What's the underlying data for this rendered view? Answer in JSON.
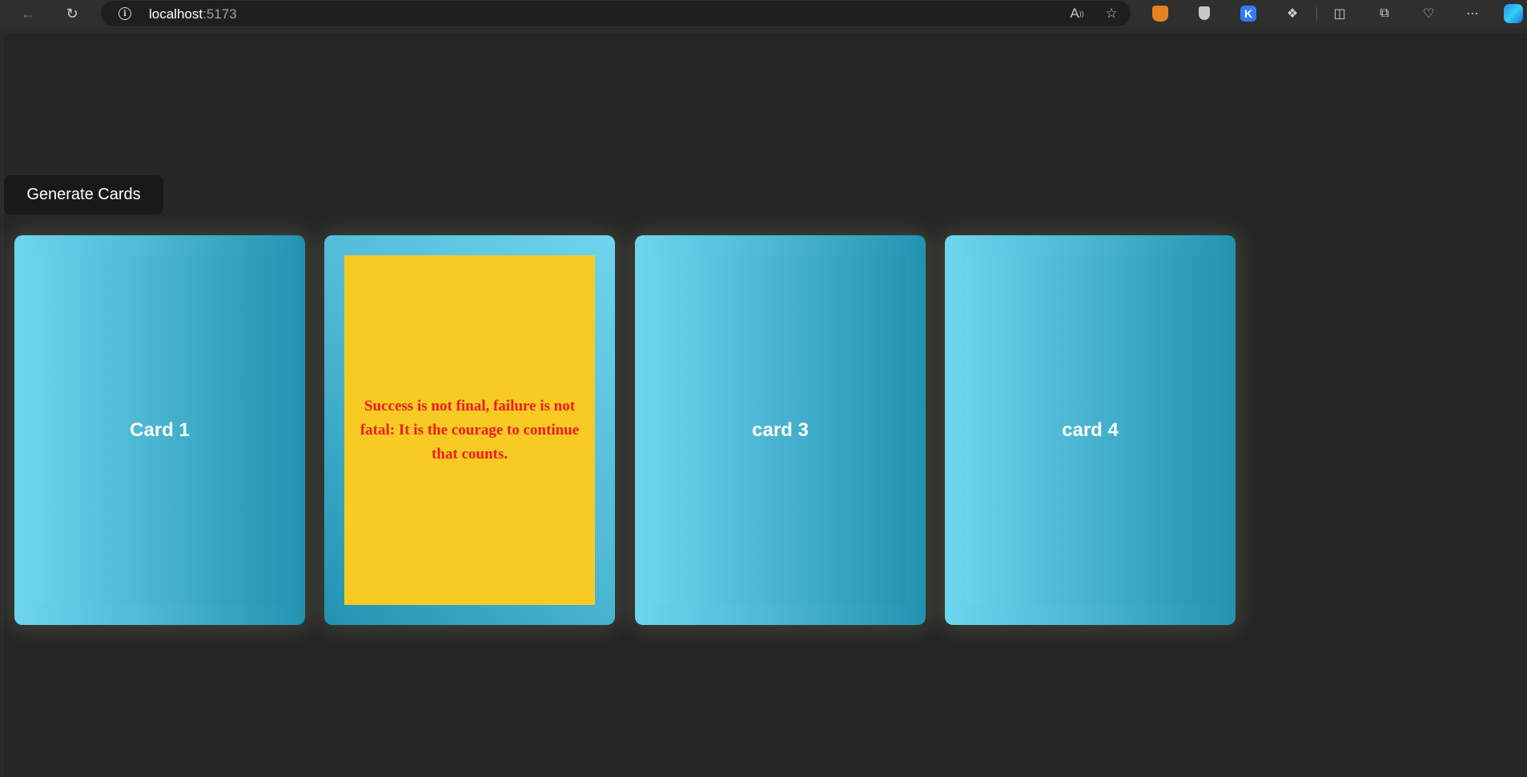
{
  "browser": {
    "url_host": "localhost",
    "url_port": ":5173"
  },
  "icons": {
    "back": "back-arrow-icon",
    "reload": "reload-icon",
    "info": "site-info-icon",
    "read_aloud": "read-aloud-icon",
    "favorite": "favorite-star-icon",
    "metamask": "metamask-extension-icon",
    "shield": "shield-extension-icon",
    "k_extension": "k-extension-icon",
    "extensions": "extensions-puzzle-icon",
    "split_screen": "split-screen-icon",
    "collections": "collections-icon",
    "browser_essentials": "browser-essentials-icon",
    "more": "more-options-icon",
    "copilot": "copilot-icon"
  },
  "page": {
    "generate_button": "Generate Cards",
    "cards": [
      {
        "label": "Card 1",
        "state": "front"
      },
      {
        "label": "Success is not final, failure is not fatal: It is the courage to continue that counts.",
        "state": "flipped"
      },
      {
        "label": "card 3",
        "state": "front"
      },
      {
        "label": "card 4",
        "state": "front"
      }
    ]
  },
  "colors": {
    "card_gradient_light": "#6dd5ed",
    "card_gradient_dark": "#2193b0",
    "quote_background": "#f8ca24",
    "quote_text": "#ee1c1c",
    "page_background": "#262626"
  }
}
